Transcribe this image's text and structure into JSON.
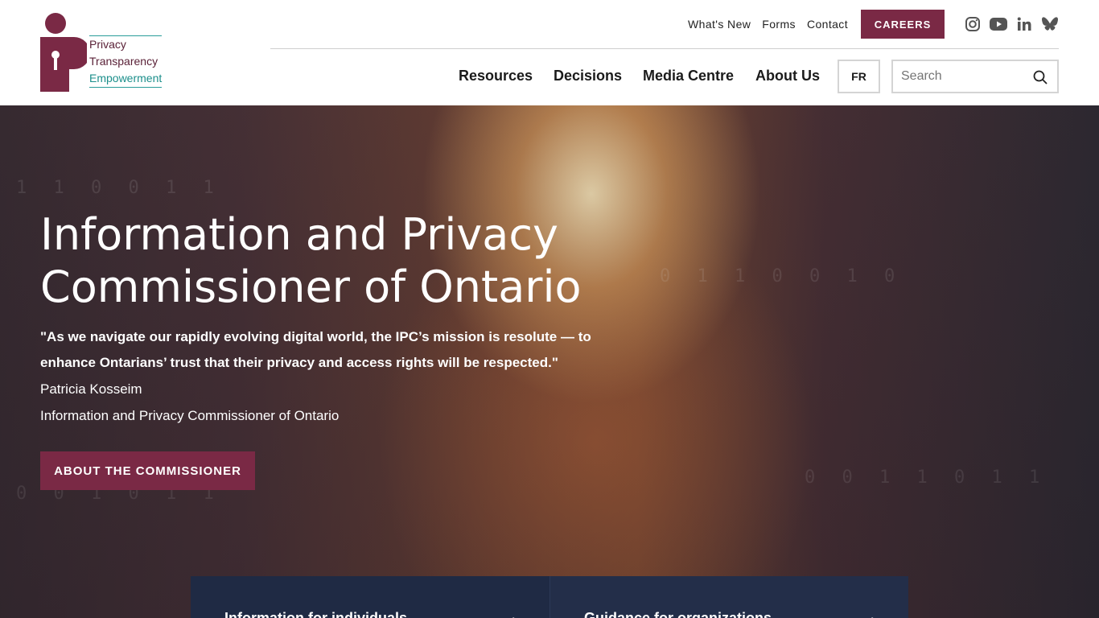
{
  "logo": {
    "words": [
      "Privacy",
      "Transparency",
      "Empowerment"
    ]
  },
  "utility_nav": {
    "links": [
      "What's New",
      "Forms",
      "Contact"
    ],
    "careers_label": "CAREERS",
    "social_icons": [
      "instagram-icon",
      "youtube-icon",
      "linkedin-icon",
      "bluesky-icon"
    ]
  },
  "main_nav": {
    "items": [
      "Resources",
      "Decisions",
      "Media Centre",
      "About Us"
    ],
    "lang_label": "FR",
    "search_placeholder": "Search"
  },
  "hero": {
    "title": "Information and Privacy Commissioner of Ontario",
    "quote": "\"As we navigate our rapidly evolving digital world, the IPC’s mission is resolute — to enhance Ontarians’ trust that their privacy and access rights will be respected.\"",
    "name": "Patricia Kosseim",
    "role": "Information and Privacy Commissioner of Ontario",
    "button_label": "ABOUT THE COMMISSIONER"
  },
  "cards": [
    {
      "label": "Information for individuals"
    },
    {
      "label": "Guidance for organizations"
    }
  ],
  "colors": {
    "brand": "#7a2945",
    "teal": "#1c8f8b",
    "card_bg": "#1f2a44"
  }
}
